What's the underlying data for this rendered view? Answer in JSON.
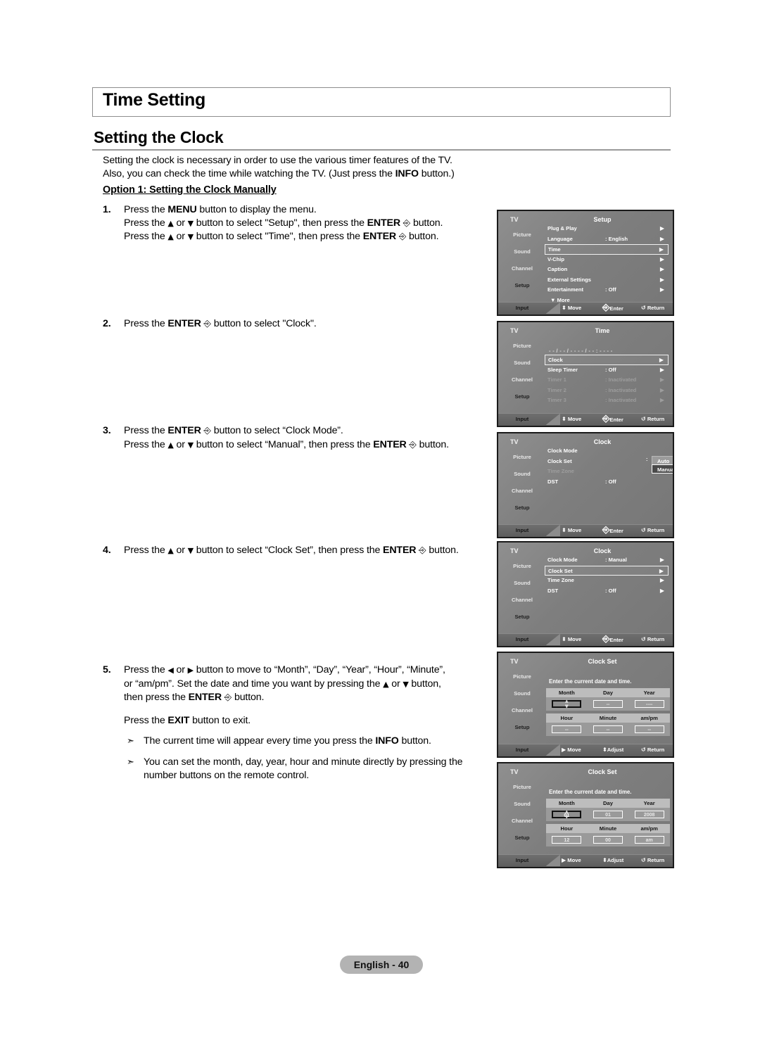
{
  "chapter": {
    "title": "Time Setting"
  },
  "section": {
    "title": "Setting the Clock"
  },
  "intro": {
    "line1": "Setting the clock is necessary in order to use the various timer features of the TV.",
    "line2_a": "Also, you can check the time while watching the TV. (Just press the ",
    "line2_b": "INFO",
    "line2_c": " button.)"
  },
  "option_heading": "Option 1: Setting the Clock Manually",
  "steps": {
    "s1": {
      "num": "1.",
      "l1_a": "Press the ",
      "l1_b": "MENU",
      "l1_c": " button to display the menu.",
      "l2_a": "Press the ",
      "l2_tri_up": "▲",
      "l2_b": " or ",
      "l2_tri_dn": "▼",
      "l2_c": " button to select \"Setup\", then press the ",
      "l2_d": "ENTER",
      "l2_e": " button.",
      "l3_a": "Press the ",
      "l3_b": " button to select \"Time\", then press the ",
      "l3_c": "ENTER",
      "l3_d": " button."
    },
    "s2": {
      "num": "2.",
      "l1_a": "Press the ",
      "l1_b": "ENTER",
      "l1_c": " button to select \"Clock\"."
    },
    "s3": {
      "num": "3.",
      "l1_a": "Press the ",
      "l1_b": "ENTER",
      "l1_c": " button to select “Clock Mode”.",
      "l2_a": "Press the ",
      "l2_b": " or ",
      "l2_c": " button to select “Manual”, then press the ",
      "l2_d": "ENTER",
      "l2_e": " button."
    },
    "s4": {
      "num": "4.",
      "l1_a": "Press the ",
      "l1_b": " or ",
      "l1_c": " button to select “Clock Set”, then press the ",
      "l1_d": "ENTER",
      "l1_e": " button."
    },
    "s5": {
      "num": "5.",
      "l1_a": "Press the ",
      "l1_tri_l": "◀",
      "l1_b": " or ",
      "l1_tri_r": "▶",
      "l1_c": " button to move to “Month”, “Day”, “Year”, “Hour”, “Minute”,",
      "l2_a": "or “am/pm”. Set the date and time you want by pressing the ",
      "l2_b": " or ",
      "l2_c": " button,",
      "l3_a": "then press the ",
      "l3_b": "ENTER",
      "l3_c": " button.",
      "exit_a": "Press the ",
      "exit_b": "EXIT",
      "exit_c": " button to exit.",
      "note1_a": "The current time will appear every time you press the ",
      "note1_b": "INFO",
      "note1_c": " button.",
      "note2": "You can set the month, day, year, hour and minute directly by pressing the number buttons on the remote control."
    }
  },
  "screens": {
    "setup": {
      "tv": "TV",
      "title": "Setup",
      "side": [
        "Picture",
        "Sound",
        "Channel",
        "Setup"
      ],
      "input": "Input",
      "rows": [
        {
          "label": "Plug & Play",
          "value": "",
          "arrow": "▶",
          "state": "normal"
        },
        {
          "label": "Language",
          "value": ": English",
          "arrow": "▶",
          "state": "normal"
        },
        {
          "label": "Time",
          "value": "",
          "arrow": "▶",
          "state": "selected"
        },
        {
          "label": "V-Chip",
          "value": "",
          "arrow": "▶",
          "state": "normal"
        },
        {
          "label": "Caption",
          "value": "",
          "arrow": "▶",
          "state": "normal"
        },
        {
          "label": "External Settings",
          "value": "",
          "arrow": "▶",
          "state": "normal"
        },
        {
          "label": "Entertainment",
          "value": ": Off",
          "arrow": "▶",
          "state": "normal"
        },
        {
          "label": "▼ More",
          "value": "",
          "arrow": "",
          "state": "more"
        }
      ],
      "bottom": {
        "move": "Move",
        "move_glyph": "⬍",
        "enter": "Enter",
        "enter_glyph": "↵",
        "return": "Return",
        "return_glyph": "↺"
      }
    },
    "time": {
      "tv": "TV",
      "title": "Time",
      "side": [
        "Picture",
        "Sound",
        "Channel",
        "Setup"
      ],
      "input": "Input",
      "datestr": "- - / - - / - - - - / - - : - -  - -",
      "rows": [
        {
          "label": "Clock",
          "value": "",
          "arrow": "▶",
          "state": "selected"
        },
        {
          "label": "Sleep Timer",
          "value": ": Off",
          "arrow": "▶",
          "state": "normal"
        },
        {
          "label": "Timer 1",
          "value": ": Inactivated",
          "arrow": "▶",
          "state": "dim"
        },
        {
          "label": "Timer 2",
          "value": ": Inactivated",
          "arrow": "▶",
          "state": "dim"
        },
        {
          "label": "Timer 3",
          "value": ": Inactivated",
          "arrow": "▶",
          "state": "dim"
        }
      ],
      "bottom": {
        "move": "Move",
        "move_glyph": "⬍",
        "enter": "Enter",
        "enter_glyph": "↵",
        "return": "Return",
        "return_glyph": "↺"
      }
    },
    "clock_mode": {
      "tv": "TV",
      "title": "Clock",
      "side": [
        "Picture",
        "Sound",
        "Channel",
        "Setup"
      ],
      "input": "Input",
      "rows": [
        {
          "label": "Clock Mode",
          "value": "",
          "arrow": "",
          "state": "normal"
        },
        {
          "label": "Clock Set",
          "value": "",
          "arrow": "",
          "state": "normal"
        },
        {
          "label": "Time Zone",
          "value": "",
          "arrow": "",
          "state": "dim"
        },
        {
          "label": "DST",
          "value": ": Off",
          "arrow": "",
          "state": "normal"
        }
      ],
      "dropdown": {
        "colon": ":",
        "auto": "Auto",
        "manual": "Manual"
      },
      "bottom": {
        "move": "Move",
        "move_glyph": "⬍",
        "enter": "Enter",
        "enter_glyph": "↵",
        "return": "Return",
        "return_glyph": "↺"
      }
    },
    "clock_set_sel": {
      "tv": "TV",
      "title": "Clock",
      "side": [
        "Picture",
        "Sound",
        "Channel",
        "Setup"
      ],
      "input": "Input",
      "rows": [
        {
          "label": "Clock Mode",
          "value": ": Manual",
          "arrow": "▶",
          "state": "normal"
        },
        {
          "label": "Clock Set",
          "value": "",
          "arrow": "▶",
          "state": "selected"
        },
        {
          "label": "Time Zone",
          "value": "",
          "arrow": "▶",
          "state": "normal"
        },
        {
          "label": "DST",
          "value": ": Off",
          "arrow": "▶",
          "state": "normal"
        }
      ],
      "bottom": {
        "move": "Move",
        "move_glyph": "⬍",
        "enter": "Enter",
        "enter_glyph": "↵",
        "return": "Return",
        "return_glyph": "↺"
      }
    },
    "clockset_empty": {
      "tv": "TV",
      "title": "Clock Set",
      "side": [
        "Picture",
        "Sound",
        "Channel",
        "Setup"
      ],
      "input": "Input",
      "prompt": "Enter the current date and time.",
      "date_headers": [
        "Month",
        "Day",
        "Year"
      ],
      "date_values": [
        "--",
        "--",
        "----"
      ],
      "time_headers": [
        "Hour",
        "Minute",
        "am/pm"
      ],
      "time_values": [
        "--",
        "--",
        "--"
      ],
      "focus_index": 0,
      "bottom": {
        "move": "Move",
        "move_glyph": "▶",
        "adjust": "Adjust",
        "adjust_glyph": "⬍",
        "return": "Return",
        "return_glyph": "↺"
      }
    },
    "clockset_filled": {
      "tv": "TV",
      "title": "Clock Set",
      "side": [
        "Picture",
        "Sound",
        "Channel",
        "Setup"
      ],
      "input": "Input",
      "prompt": "Enter the current date and time.",
      "date_headers": [
        "Month",
        "Day",
        "Year"
      ],
      "date_values": [
        "01",
        "01",
        "2008"
      ],
      "time_headers": [
        "Hour",
        "Minute",
        "am/pm"
      ],
      "time_values": [
        "12",
        "00",
        "am"
      ],
      "focus_index": 0,
      "bottom": {
        "move": "Move",
        "move_glyph": "▶",
        "adjust": "Adjust",
        "adjust_glyph": "⬍",
        "return": "Return",
        "return_glyph": "↺"
      }
    }
  },
  "footer": {
    "page_label": "English - 40"
  }
}
